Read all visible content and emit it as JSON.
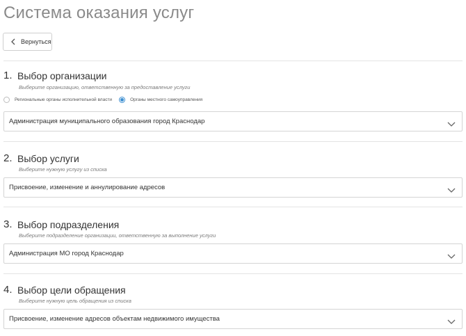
{
  "page": {
    "title": "Система оказания услуг",
    "back_label": "Вернуться"
  },
  "sections": [
    {
      "number": "1.",
      "title": "Выбор организации",
      "hint": "Выберите организацию, ответственную за предоставление услуги",
      "radios": [
        {
          "label": "Региональные органы исполнительной власти",
          "checked": false
        },
        {
          "label": "Органы местного самоуправления",
          "checked": true
        }
      ],
      "select_value": "Администрация муниципального образования город Краснодар"
    },
    {
      "number": "2.",
      "title": "Выбор услуги",
      "hint": "Выберите нужную услугу из списка",
      "select_value": "Присвоение, изменение и аннулирование адресов"
    },
    {
      "number": "3.",
      "title": "Выбор подразделения",
      "hint": "Выберите подразделение организации, ответственную за выполнение услуги",
      "select_value": "Администрация МО город Краснодар"
    },
    {
      "number": "4.",
      "title": "Выбор цели обращения",
      "hint": "Выберите нужную цель обращения из списка",
      "select_value": "Присвоение, изменение адресов объектам недвижимого имущества"
    }
  ],
  "icons": {
    "back": "chevron-left-icon",
    "select_arrow": "chevron-down-icon"
  },
  "colors": {
    "accent": "#3d8fd1",
    "title": "#8a8a8a",
    "border": "#d4d4d4"
  }
}
